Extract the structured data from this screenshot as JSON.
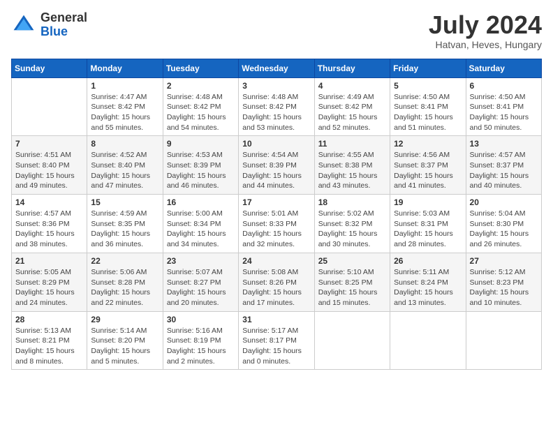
{
  "header": {
    "logo_general": "General",
    "logo_blue": "Blue",
    "month_year": "July 2024",
    "location": "Hatvan, Heves, Hungary"
  },
  "days_of_week": [
    "Sunday",
    "Monday",
    "Tuesday",
    "Wednesday",
    "Thursday",
    "Friday",
    "Saturday"
  ],
  "weeks": [
    [
      {
        "day": "",
        "info": ""
      },
      {
        "day": "1",
        "info": "Sunrise: 4:47 AM\nSunset: 8:42 PM\nDaylight: 15 hours\nand 55 minutes."
      },
      {
        "day": "2",
        "info": "Sunrise: 4:48 AM\nSunset: 8:42 PM\nDaylight: 15 hours\nand 54 minutes."
      },
      {
        "day": "3",
        "info": "Sunrise: 4:48 AM\nSunset: 8:42 PM\nDaylight: 15 hours\nand 53 minutes."
      },
      {
        "day": "4",
        "info": "Sunrise: 4:49 AM\nSunset: 8:42 PM\nDaylight: 15 hours\nand 52 minutes."
      },
      {
        "day": "5",
        "info": "Sunrise: 4:50 AM\nSunset: 8:41 PM\nDaylight: 15 hours\nand 51 minutes."
      },
      {
        "day": "6",
        "info": "Sunrise: 4:50 AM\nSunset: 8:41 PM\nDaylight: 15 hours\nand 50 minutes."
      }
    ],
    [
      {
        "day": "7",
        "info": "Sunrise: 4:51 AM\nSunset: 8:40 PM\nDaylight: 15 hours\nand 49 minutes."
      },
      {
        "day": "8",
        "info": "Sunrise: 4:52 AM\nSunset: 8:40 PM\nDaylight: 15 hours\nand 47 minutes."
      },
      {
        "day": "9",
        "info": "Sunrise: 4:53 AM\nSunset: 8:39 PM\nDaylight: 15 hours\nand 46 minutes."
      },
      {
        "day": "10",
        "info": "Sunrise: 4:54 AM\nSunset: 8:39 PM\nDaylight: 15 hours\nand 44 minutes."
      },
      {
        "day": "11",
        "info": "Sunrise: 4:55 AM\nSunset: 8:38 PM\nDaylight: 15 hours\nand 43 minutes."
      },
      {
        "day": "12",
        "info": "Sunrise: 4:56 AM\nSunset: 8:37 PM\nDaylight: 15 hours\nand 41 minutes."
      },
      {
        "day": "13",
        "info": "Sunrise: 4:57 AM\nSunset: 8:37 PM\nDaylight: 15 hours\nand 40 minutes."
      }
    ],
    [
      {
        "day": "14",
        "info": "Sunrise: 4:57 AM\nSunset: 8:36 PM\nDaylight: 15 hours\nand 38 minutes."
      },
      {
        "day": "15",
        "info": "Sunrise: 4:59 AM\nSunset: 8:35 PM\nDaylight: 15 hours\nand 36 minutes."
      },
      {
        "day": "16",
        "info": "Sunrise: 5:00 AM\nSunset: 8:34 PM\nDaylight: 15 hours\nand 34 minutes."
      },
      {
        "day": "17",
        "info": "Sunrise: 5:01 AM\nSunset: 8:33 PM\nDaylight: 15 hours\nand 32 minutes."
      },
      {
        "day": "18",
        "info": "Sunrise: 5:02 AM\nSunset: 8:32 PM\nDaylight: 15 hours\nand 30 minutes."
      },
      {
        "day": "19",
        "info": "Sunrise: 5:03 AM\nSunset: 8:31 PM\nDaylight: 15 hours\nand 28 minutes."
      },
      {
        "day": "20",
        "info": "Sunrise: 5:04 AM\nSunset: 8:30 PM\nDaylight: 15 hours\nand 26 minutes."
      }
    ],
    [
      {
        "day": "21",
        "info": "Sunrise: 5:05 AM\nSunset: 8:29 PM\nDaylight: 15 hours\nand 24 minutes."
      },
      {
        "day": "22",
        "info": "Sunrise: 5:06 AM\nSunset: 8:28 PM\nDaylight: 15 hours\nand 22 minutes."
      },
      {
        "day": "23",
        "info": "Sunrise: 5:07 AM\nSunset: 8:27 PM\nDaylight: 15 hours\nand 20 minutes."
      },
      {
        "day": "24",
        "info": "Sunrise: 5:08 AM\nSunset: 8:26 PM\nDaylight: 15 hours\nand 17 minutes."
      },
      {
        "day": "25",
        "info": "Sunrise: 5:10 AM\nSunset: 8:25 PM\nDaylight: 15 hours\nand 15 minutes."
      },
      {
        "day": "26",
        "info": "Sunrise: 5:11 AM\nSunset: 8:24 PM\nDaylight: 15 hours\nand 13 minutes."
      },
      {
        "day": "27",
        "info": "Sunrise: 5:12 AM\nSunset: 8:23 PM\nDaylight: 15 hours\nand 10 minutes."
      }
    ],
    [
      {
        "day": "28",
        "info": "Sunrise: 5:13 AM\nSunset: 8:21 PM\nDaylight: 15 hours\nand 8 minutes."
      },
      {
        "day": "29",
        "info": "Sunrise: 5:14 AM\nSunset: 8:20 PM\nDaylight: 15 hours\nand 5 minutes."
      },
      {
        "day": "30",
        "info": "Sunrise: 5:16 AM\nSunset: 8:19 PM\nDaylight: 15 hours\nand 2 minutes."
      },
      {
        "day": "31",
        "info": "Sunrise: 5:17 AM\nSunset: 8:17 PM\nDaylight: 15 hours\nand 0 minutes."
      },
      {
        "day": "",
        "info": ""
      },
      {
        "day": "",
        "info": ""
      },
      {
        "day": "",
        "info": ""
      }
    ]
  ]
}
